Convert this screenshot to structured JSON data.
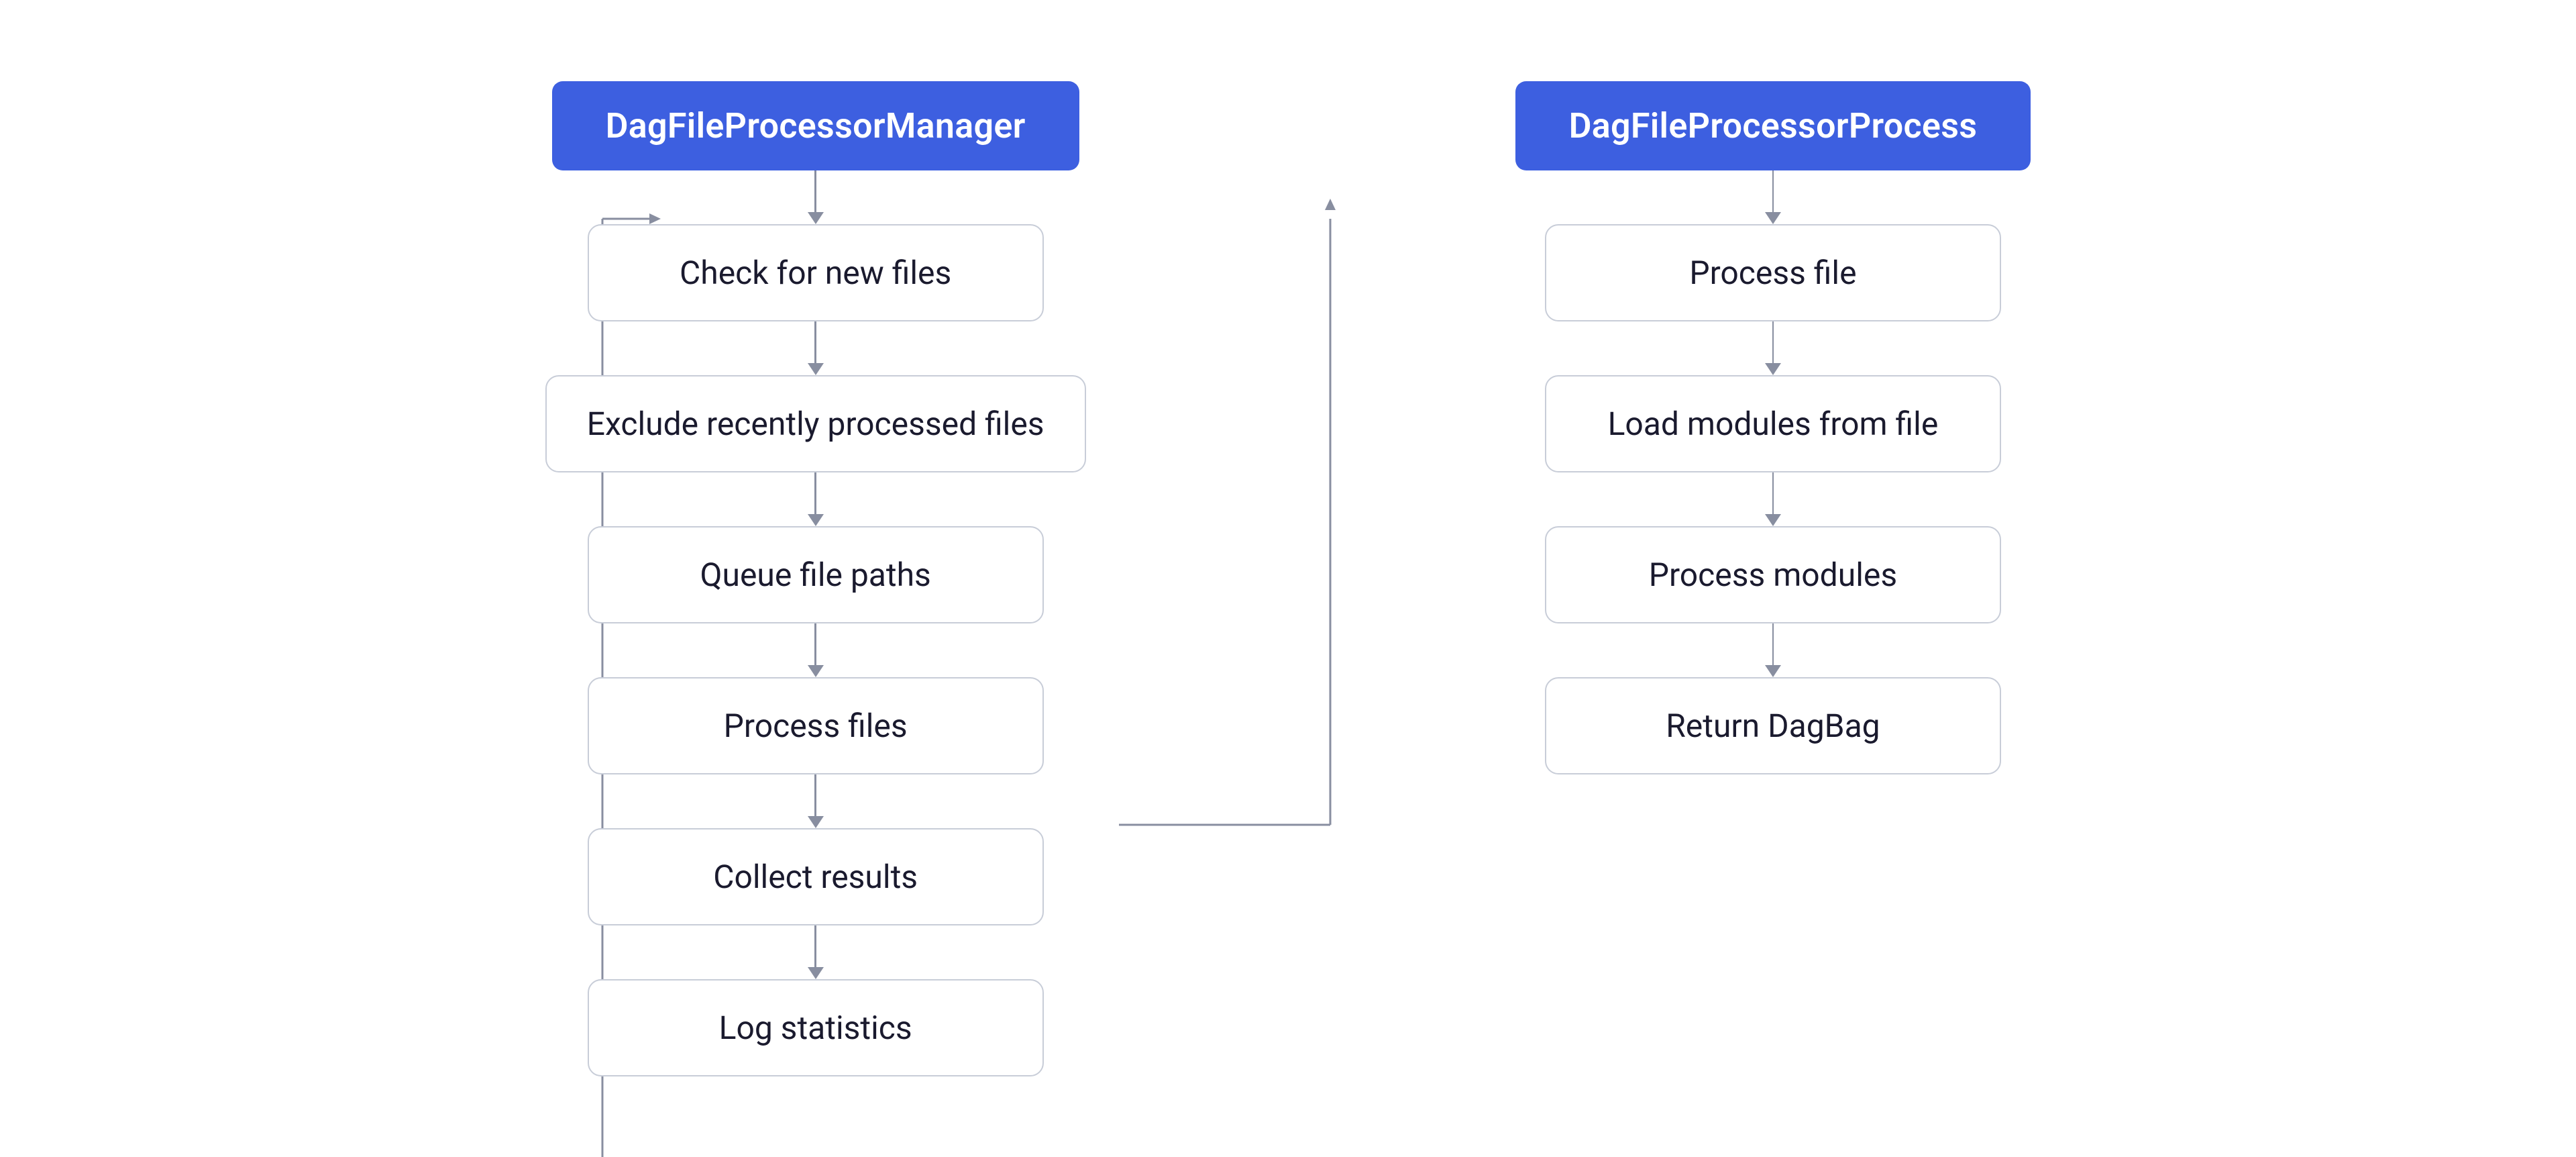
{
  "left_column": {
    "header": "DagFileProcessorManager",
    "steps": [
      "Check for new files",
      "Exclude recently processed files",
      "Queue file paths",
      "Process files",
      "Collect results",
      "Log statistics"
    ]
  },
  "right_column": {
    "header": "DagFileProcessorProcess",
    "steps": [
      "Process file",
      "Load modules from file",
      "Process modules",
      "Return DagBag"
    ]
  },
  "colors": {
    "header_bg": "#3d5fe0",
    "header_text": "#ffffff",
    "step_border": "#c8cdd8",
    "step_text": "#1a1a2e",
    "arrow": "#888ea0",
    "bg": "#ffffff"
  }
}
